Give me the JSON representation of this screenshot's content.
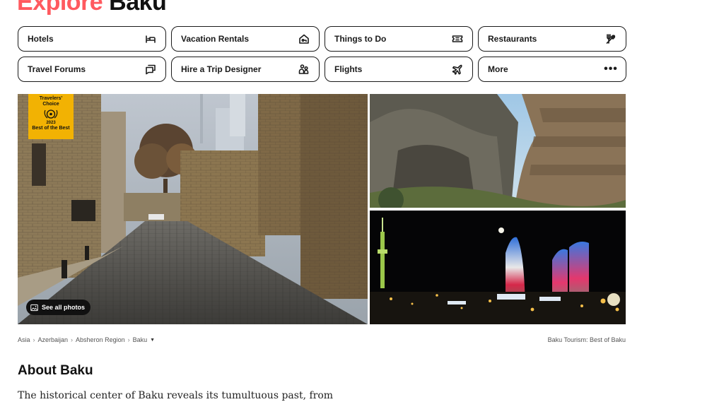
{
  "header": {
    "title_accent": "Explore",
    "title_place": "Baku"
  },
  "nav": {
    "items": [
      {
        "label": "Hotels",
        "icon": "bed-icon"
      },
      {
        "label": "Vacation Rentals",
        "icon": "house-key-icon"
      },
      {
        "label": "Things to Do",
        "icon": "ticket-icon"
      },
      {
        "label": "Restaurants",
        "icon": "fork-knife-icon"
      },
      {
        "label": "Travel Forums",
        "icon": "chat-bubbles-icon"
      },
      {
        "label": "Hire a Trip Designer",
        "icon": "people-icon"
      },
      {
        "label": "Flights",
        "icon": "airplane-icon"
      },
      {
        "label": "More",
        "icon": "more-dots-icon"
      }
    ]
  },
  "gallery": {
    "badge": {
      "line1": "Travelers'",
      "line2": "Choice",
      "year": "2023",
      "line3": "Best of the Best"
    },
    "see_all_label": "See all photos"
  },
  "breadcrumb": {
    "items": [
      "Asia",
      "Azerbaijan",
      "Absheron Region",
      "Baku"
    ]
  },
  "tourism_link": "Baku Tourism: Best of Baku",
  "about": {
    "heading": "About Baku",
    "text": "The historical center of Baku reveals its tumultuous past, from"
  },
  "colors": {
    "accent": "#ff5a5f",
    "badge": "#f2b203",
    "text": "#1a1a1a"
  }
}
